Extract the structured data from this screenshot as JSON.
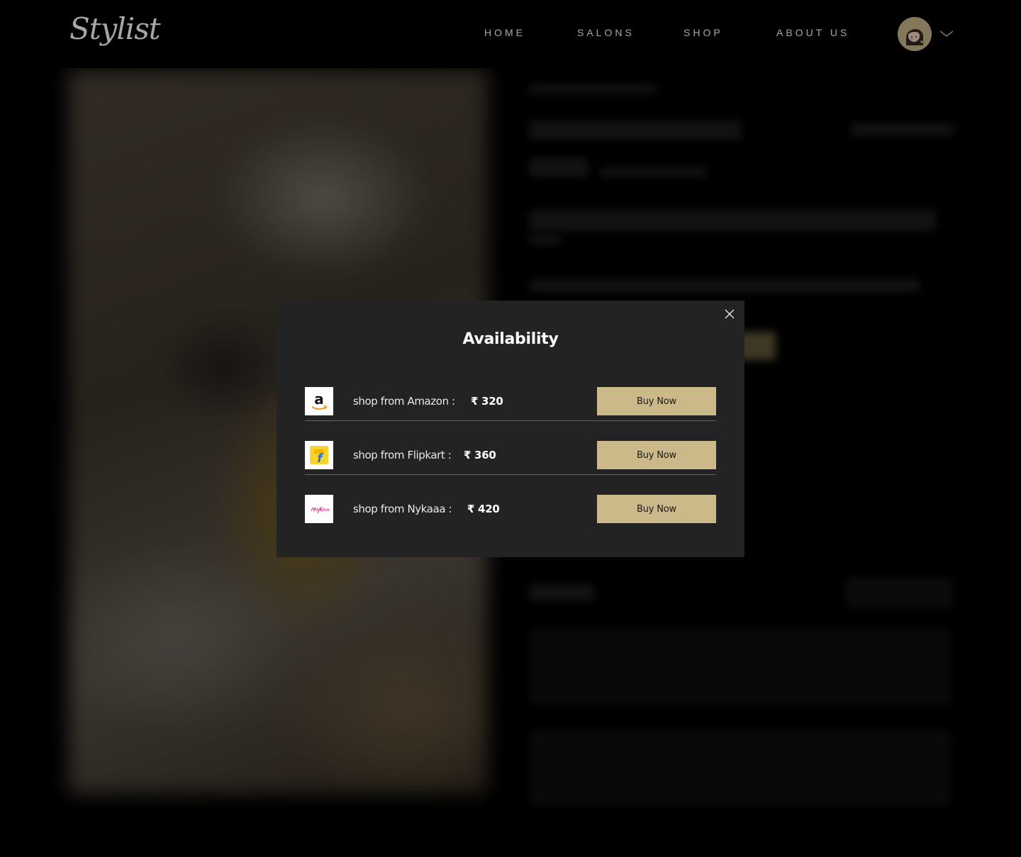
{
  "brand": {
    "logo_text": "Stylist"
  },
  "nav": {
    "items": [
      {
        "label": "HOME"
      },
      {
        "label": "SALONS"
      },
      {
        "label": "SHOP"
      },
      {
        "label": "ABOUT US"
      }
    ]
  },
  "user": {
    "avatar_icon": "user-avatar-icon",
    "menu_icon": "chevron-down-icon"
  },
  "modal": {
    "title": "Availability",
    "close_icon": "close-icon",
    "stores": [
      {
        "label": "shop from Amazon :",
        "price": "₹ 320",
        "button": "Buy Now",
        "logo_icon": "amazon-logo-icon"
      },
      {
        "label": "shop from Flipkart :",
        "price": "₹ 360",
        "button": "Buy Now",
        "logo_icon": "flipkart-logo-icon"
      },
      {
        "label": "shop from Nykaaa :",
        "price": "₹ 420",
        "button": "Buy Now",
        "logo_icon": "nykaa-logo-icon"
      }
    ]
  },
  "colors": {
    "accent": "#cbb98a",
    "modal_bg": "#232323",
    "page_bg": "#000000",
    "divider": "#6b6450"
  }
}
